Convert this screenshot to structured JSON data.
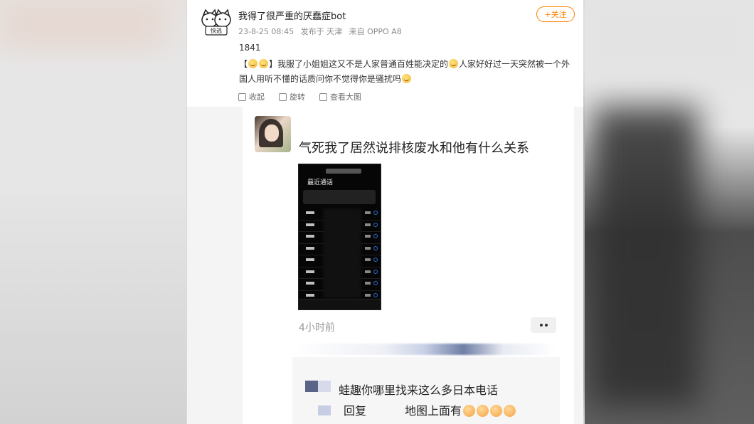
{
  "post": {
    "username": "我得了很严重的厌蠢症bot",
    "date": "23-8-25 08:45",
    "location": "发布于 天津",
    "source": "来自 OPPO A8",
    "follow_label": "+关注",
    "count": "1841",
    "text_prefix": "【",
    "text_a": "】我服了小姐姐这又不是人家普通百姓能决定的",
    "text_b": "人家好好过一天突然被一个外国人用听不懂的话质问你不觉得你是骚扰吗",
    "logo_icon": "cat-logo-icon"
  },
  "actions": {
    "collect": "收起",
    "rotate": "旋转",
    "view_large": "查看大图"
  },
  "screenshot": {
    "message": "气死我了居然说排核废水和他有什么关系",
    "phone_title": "最近通话",
    "time": "4小时前",
    "reply_line1": "蛙趣你哪里找来这么多日本电话",
    "reply_prefix": "回复",
    "reply_text": "地图上面有"
  },
  "colors": {
    "accent": "#ff8200",
    "text": "#333333",
    "meta": "#8c8c8c"
  }
}
